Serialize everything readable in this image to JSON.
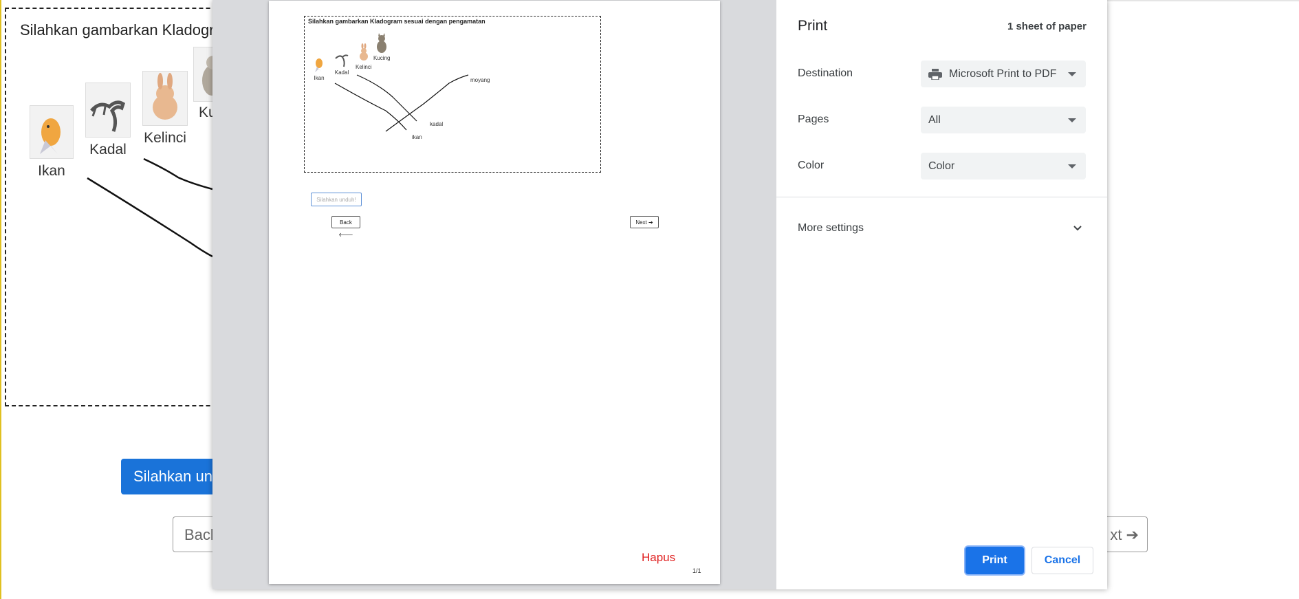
{
  "background_page": {
    "title": "Silahkan gambarkan Kladogra",
    "animals": [
      "Ikan",
      "Kadal",
      "Kelinci",
      "Kuc"
    ],
    "upload_button": "Silahkan und",
    "back_button": "Back",
    "next_button": "xt ➔"
  },
  "preview": {
    "canvas_title": "Silahkan gambarkan Kladogram sesuai dengan pengamatan",
    "animals": [
      "Ikan",
      "Kadal",
      "Kelinci",
      "Kucing"
    ],
    "drawn_labels": {
      "moyang": "moyang",
      "kadal": "kadal",
      "ikan": "ikan"
    },
    "upload_button": "Silahkan unduh!",
    "back_button": "Back 🡐",
    "next_button": "Next ➔",
    "hapus": "Hapus",
    "page_number": "1/1"
  },
  "print_settings": {
    "title": "Print",
    "sheet_count": "1 sheet of paper",
    "destination_label": "Destination",
    "destination_value": "Microsoft Print to PDF",
    "pages_label": "Pages",
    "pages_value": "All",
    "color_label": "Color",
    "color_value": "Color",
    "more_settings": "More settings",
    "print_button": "Print",
    "cancel_button": "Cancel"
  }
}
